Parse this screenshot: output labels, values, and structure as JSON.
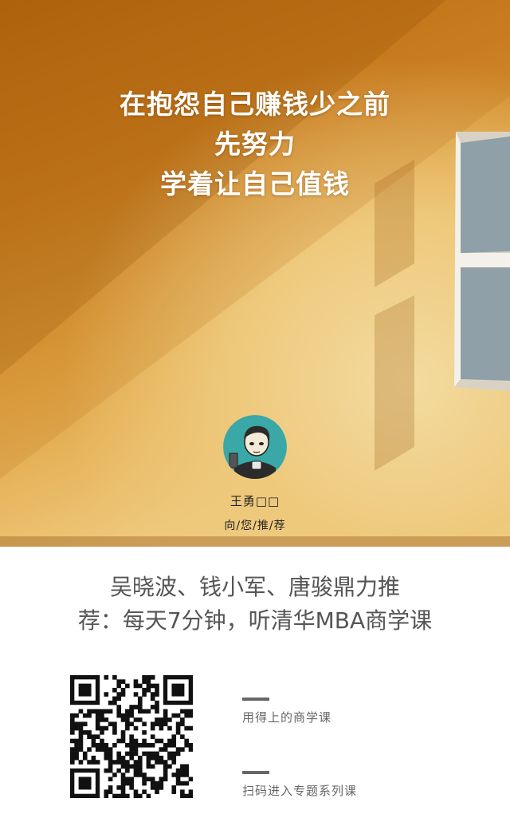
{
  "poster": {
    "quote_lines": [
      "在抱怨自己赚钱少之前",
      "先努力",
      "学着让自己值钱"
    ],
    "user_name": "王勇□□",
    "recommend_text": "向/您/推/荐"
  },
  "promo": {
    "headline_lines": [
      "吴晓波、钱小军、唐骏鼎力推",
      "荐：每天7分钟，听清华MBA商学课"
    ],
    "tagline_1": "用得上的商学课",
    "tagline_2": "扫码进入专题系列课"
  },
  "icons": {
    "avatar": "cartoon-man-avatar",
    "qr": "qr-code"
  },
  "colors": {
    "wall_dark": "#b9680e",
    "wall_light": "#f2d594",
    "headline_text": "#555555",
    "tagline_text": "#666666"
  }
}
